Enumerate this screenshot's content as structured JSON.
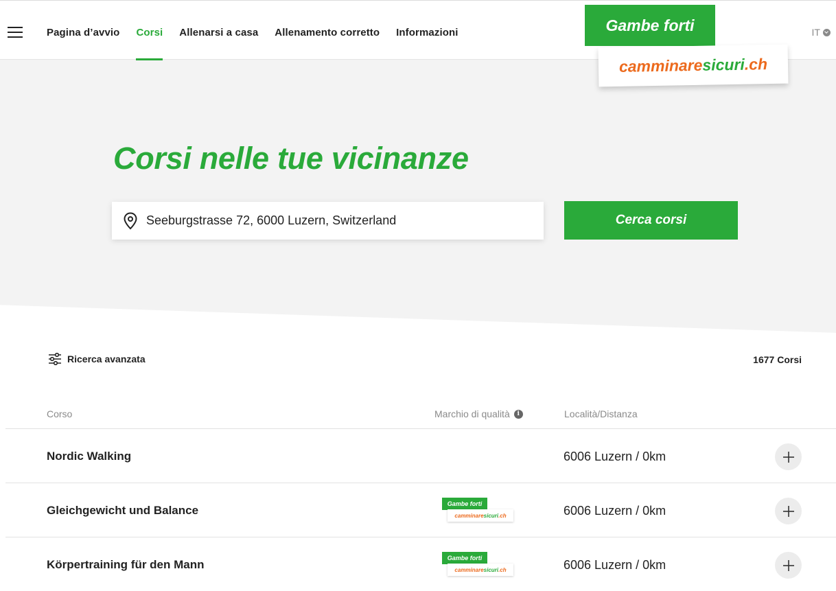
{
  "nav": {
    "items": [
      {
        "label": "Pagina d’avvio",
        "active": false
      },
      {
        "label": "Corsi",
        "active": true
      },
      {
        "label": "Allenarsi a casa",
        "active": false
      },
      {
        "label": "Allenamento corretto",
        "active": false
      },
      {
        "label": "Informazioni",
        "active": false
      }
    ],
    "language": "IT"
  },
  "logo": {
    "top_text": "Gambe forti",
    "bottom_part1": "camminare",
    "bottom_part2": "sicuri",
    "bottom_part3": ".ch"
  },
  "hero": {
    "title": "Corsi nelle tue vicinanze",
    "search_value": "Seeburgstrasse 72, 6000 Luzern, Switzerland",
    "search_button": "Cerca corsi"
  },
  "filters": {
    "advanced_label": "Ricerca avanzata",
    "count_label": "1677 Corsi"
  },
  "table": {
    "headers": {
      "course": "Corso",
      "quality": "Marchio di qualità",
      "location": "Località/Distanza"
    },
    "rows": [
      {
        "name": "Nordic Walking",
        "location": "6006 Luzern / 0km",
        "quality_badge": false
      },
      {
        "name": "Gleichgewicht und Balance",
        "location": "6006 Luzern / 0km",
        "quality_badge": true
      },
      {
        "name": "Körpertraining für den Mann",
        "location": "6006 Luzern / 0km",
        "quality_badge": true
      }
    ]
  },
  "colors": {
    "brand_green": "#2aaa3a",
    "brand_orange": "#ec6a1d",
    "hero_bg": "#f3f3f3"
  }
}
